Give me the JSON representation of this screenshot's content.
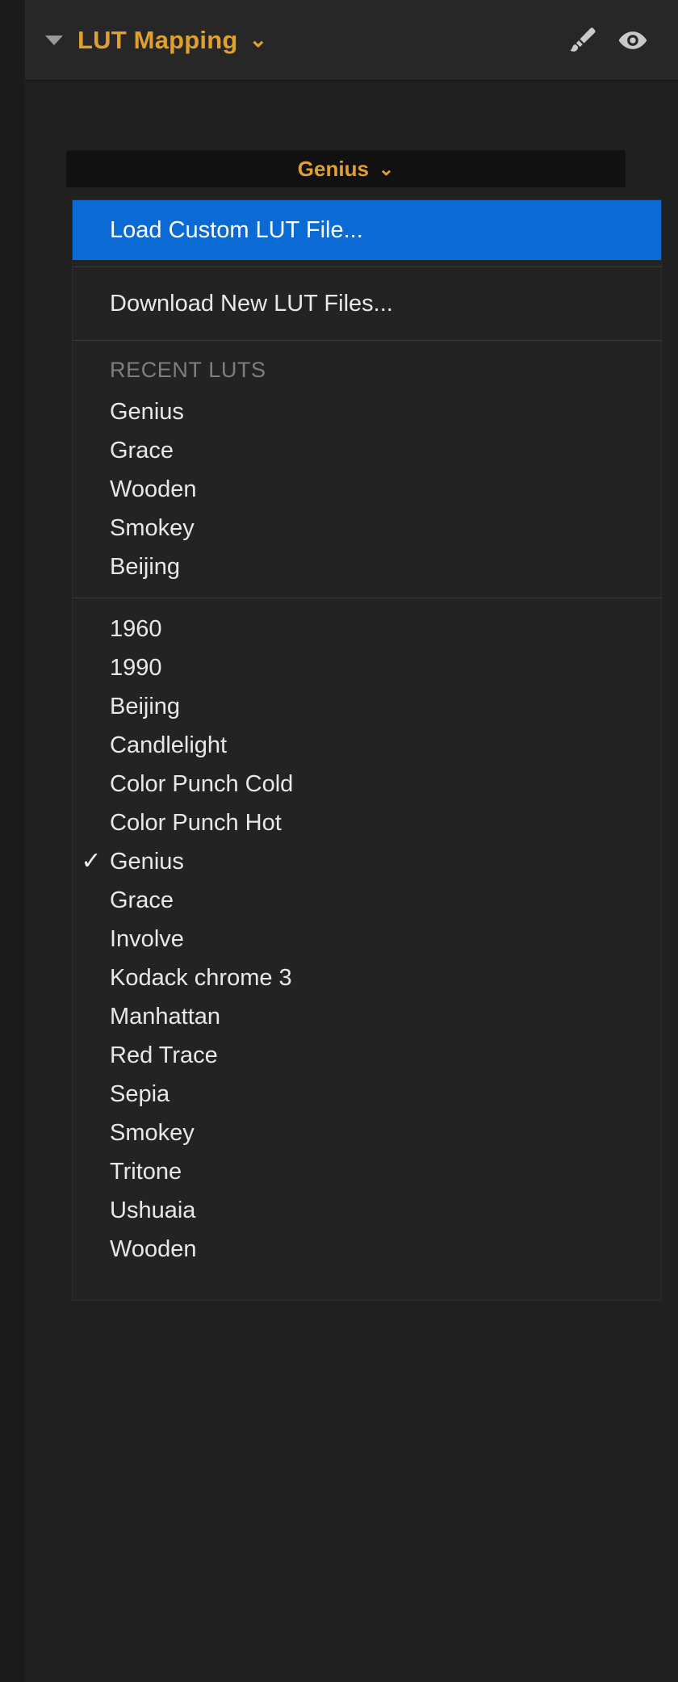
{
  "header": {
    "title": "LUT Mapping",
    "disclosure_icon": "triangle-down-icon",
    "title_chevron": "chevron-down-icon",
    "brush_icon": "paintbrush-icon",
    "eye_icon": "eye-icon"
  },
  "combo": {
    "value": "Genius",
    "chevron": "chevron-down-icon"
  },
  "menu": {
    "actions": [
      {
        "label": "Load Custom LUT File...",
        "highlighted": true
      },
      {
        "label": "Download New LUT Files...",
        "highlighted": false
      }
    ],
    "recent_section_label": "RECENT LUTS",
    "recent": [
      "Genius",
      "Grace",
      "Wooden",
      "Smokey",
      "Beijing"
    ],
    "all_luts": [
      {
        "label": "1960",
        "checked": false
      },
      {
        "label": "1990",
        "checked": false
      },
      {
        "label": "Beijing",
        "checked": false
      },
      {
        "label": "Candlelight",
        "checked": false
      },
      {
        "label": "Color Punch Cold",
        "checked": false
      },
      {
        "label": "Color Punch Hot",
        "checked": false
      },
      {
        "label": "Genius",
        "checked": true
      },
      {
        "label": "Grace",
        "checked": false
      },
      {
        "label": "Involve",
        "checked": false
      },
      {
        "label": "Kodack chrome  3",
        "checked": false
      },
      {
        "label": "Manhattan",
        "checked": false
      },
      {
        "label": "Red Trace",
        "checked": false
      },
      {
        "label": "Sepia",
        "checked": false
      },
      {
        "label": "Smokey",
        "checked": false
      },
      {
        "label": "Tritone",
        "checked": false
      },
      {
        "label": "Ushuaia",
        "checked": false
      },
      {
        "label": "Wooden",
        "checked": false
      }
    ],
    "check_glyph": "✓"
  },
  "colors": {
    "accent_gold": "#e0a030",
    "highlight_blue": "#0b6ad4",
    "panel_bg": "#202020",
    "menu_bg": "#232323",
    "header_bg": "#272727",
    "text": "#e8e8e8",
    "muted_text": "#7e7e7e"
  }
}
